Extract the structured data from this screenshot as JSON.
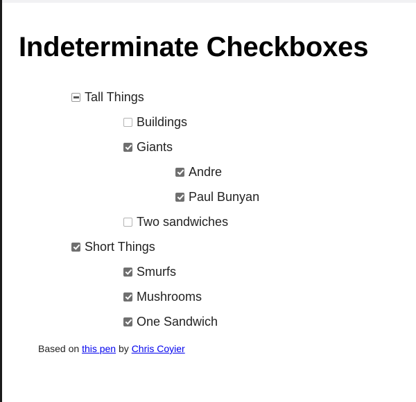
{
  "page": {
    "title": "Indeterminate Checkboxes"
  },
  "tree": {
    "nodes": [
      {
        "label": "Tall Things",
        "state": "indeterminate",
        "level": 1
      },
      {
        "label": "Buildings",
        "state": "unchecked",
        "level": 2
      },
      {
        "label": "Giants",
        "state": "checked",
        "level": 2
      },
      {
        "label": "Andre",
        "state": "checked",
        "level": 3
      },
      {
        "label": "Paul Bunyan",
        "state": "checked",
        "level": 3
      },
      {
        "label": "Two sandwiches",
        "state": "unchecked",
        "level": 2
      },
      {
        "label": "Short Things",
        "state": "checked",
        "level": 1
      },
      {
        "label": "Smurfs",
        "state": "checked",
        "level": 2
      },
      {
        "label": "Mushrooms",
        "state": "checked",
        "level": 2
      },
      {
        "label": "One Sandwich",
        "state": "checked",
        "level": 2
      }
    ]
  },
  "credit": {
    "prefix": "Based on ",
    "link1_text": "this pen",
    "middle": " by ",
    "link2_text": "Chris Coyier",
    "link_color": "#0000ee"
  },
  "colors": {
    "checkbox_checked_fill": "#6f6f6f",
    "checkbox_border": "#b3b3b3",
    "text": "#222222",
    "title": "#000000",
    "left_rule": "#1b1b1b"
  }
}
